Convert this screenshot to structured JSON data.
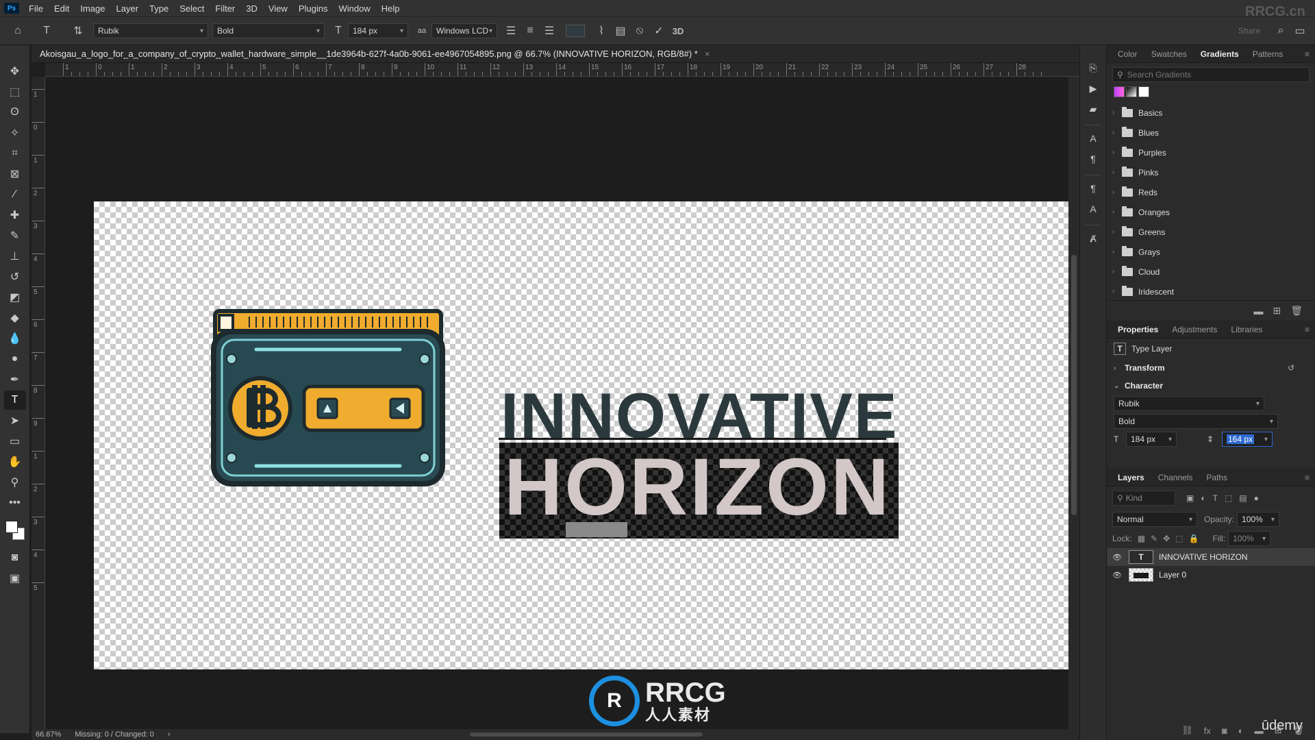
{
  "menu": [
    "File",
    "Edit",
    "Image",
    "Layer",
    "Type",
    "Select",
    "Filter",
    "3D",
    "View",
    "Plugins",
    "Window",
    "Help"
  ],
  "app_badge": "Ps",
  "options": {
    "font_family": "Rubik",
    "font_style": "Bold",
    "font_size": "184 px",
    "aa_icon": "aa",
    "anti_alias": "Windows LCD",
    "threed": "3D",
    "share": "Share"
  },
  "document": {
    "tab_title": "Akoisgau_a_logo_for_a_company_of_crypto_wallet_hardware_simple__1de3964b-627f-4a0b-9061-ee4967054895.png @ 66.7% (INNOVATIVE  HORIZON, RGB/8#) *",
    "close": "×",
    "headline": "INNOVATIVE",
    "subline": "HORIZON",
    "ruler_top": [
      "1",
      "0",
      "1",
      "2",
      "3",
      "4",
      "5",
      "6",
      "7",
      "8",
      "9",
      "10",
      "11",
      "12",
      "13",
      "14",
      "15",
      "16",
      "17",
      "18",
      "19",
      "20",
      "21",
      "22",
      "23",
      "24",
      "25",
      "26",
      "27",
      "28"
    ],
    "ruler_left": [
      "1",
      "0",
      "1",
      "2",
      "3",
      "4",
      "5",
      "6",
      "7",
      "8",
      "9",
      "1",
      "2",
      "3",
      "4",
      "5"
    ]
  },
  "status": {
    "zoom": "66.67%",
    "info": "Missing: 0 / Changed: 0",
    "arrow": "›"
  },
  "panels": {
    "top_tabs": [
      "Color",
      "Swatches",
      "Gradients",
      "Patterns"
    ],
    "search_placeholder": "Search Gradients",
    "gradients": [
      "Basics",
      "Blues",
      "Purples",
      "Pinks",
      "Reds",
      "Oranges",
      "Greens",
      "Grays",
      "Cloud",
      "Iridescent"
    ],
    "prop_tabs": [
      "Properties",
      "Adjustments",
      "Libraries"
    ],
    "type_layer": "Type Layer",
    "transform": "Transform",
    "character": "Character",
    "char_font": "Rubik",
    "char_style": "Bold",
    "char_size": "184 px",
    "char_leading": "164 px",
    "layer_tabs": [
      "Layers",
      "Channels",
      "Paths"
    ],
    "kind": "Kind",
    "blend_mode": "Normal",
    "opacity_label": "Opacity:",
    "opacity": "100%",
    "lock_label": "Lock:",
    "fill_label": "Fill:",
    "fill": "100%",
    "layers": [
      "INNOVATIVE  HORIZON",
      "Layer 0"
    ]
  },
  "watermark": {
    "top": "RRCG.cn",
    "logo_mark": "R",
    "brand": "RRCG",
    "brand_cn": "人人素材",
    "udemy": "ūdemy"
  },
  "colors": {
    "accent": "#2d6ad1",
    "logo_dark": "#2b393d",
    "logo_light": "#d3c7c7",
    "logo_orange": "#f0ac2e",
    "logo_teal": "#274a52"
  }
}
